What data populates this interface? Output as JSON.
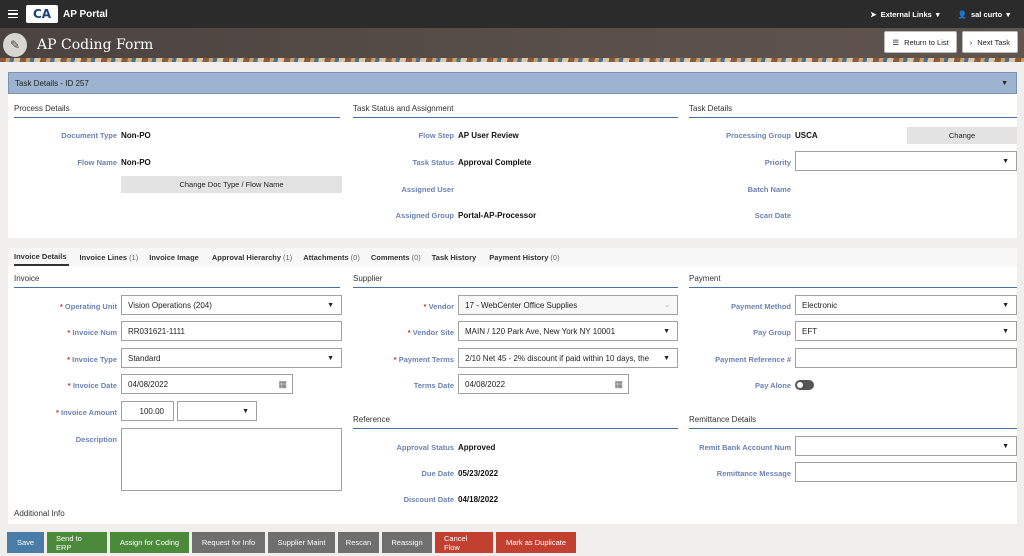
{
  "app": {
    "name": "AP Portal",
    "logo": "CA",
    "external_links": "External Links",
    "user": "sal curto"
  },
  "header": {
    "title": "AP Coding Form",
    "return_label": "Return to List",
    "next_label": "Next Task"
  },
  "panel": {
    "title": "Task Details - ID 257"
  },
  "process": {
    "heading": "Process Details",
    "doc_type_label": "Document Type",
    "doc_type": "Non-PO",
    "flow_name_label": "Flow Name",
    "flow_name": "Non-PO",
    "change_btn": "Change Doc Type / Flow Name"
  },
  "status": {
    "heading": "Task Status and Assignment",
    "flow_step_label": "Flow Step",
    "flow_step": "AP User Review",
    "task_status_label": "Task Status",
    "task_status": "Approval Complete",
    "assigned_user_label": "Assigned User",
    "assigned_group_label": "Assigned Group",
    "assigned_group": "Portal-AP-Processor"
  },
  "taskdetails": {
    "heading": "Task Details",
    "proc_group_label": "Processing Group",
    "proc_group": "USCA",
    "change_btn": "Change",
    "priority_label": "Priority",
    "batch_label": "Batch Name",
    "scan_label": "Scan Date"
  },
  "tabs": [
    {
      "label": "Invoice Details",
      "count": ""
    },
    {
      "label": "Invoice Lines",
      "count": "(1)"
    },
    {
      "label": "Invoice Image",
      "count": ""
    },
    {
      "label": "Approval Hierarchy",
      "count": "(1)"
    },
    {
      "label": "Attachments",
      "count": "(0)"
    },
    {
      "label": "Comments",
      "count": "(0)"
    },
    {
      "label": "Task History",
      "count": ""
    },
    {
      "label": "Payment History",
      "count": "(0)"
    }
  ],
  "invoice": {
    "heading": "Invoice",
    "op_unit_label": "Operating Unit",
    "op_unit": "Vision Operations (204)",
    "inv_num_label": "Invoice Num",
    "inv_num": "RR031621-1111",
    "inv_type_label": "Invoice Type",
    "inv_type": "Standard",
    "inv_date_label": "Invoice Date",
    "inv_date": "04/08/2022",
    "amount_label": "Invoice Amount",
    "amount": "100.00",
    "desc_label": "Description",
    "additional": "Additional Info"
  },
  "supplier": {
    "heading": "Supplier",
    "vendor_label": "Vendor",
    "vendor": "17 - WebCenter Office Supplies",
    "site_label": "Vendor Site",
    "site": "MAIN / 120 Park Ave, New York NY 10001",
    "terms_label": "Payment Terms",
    "terms": "2/10 Net 45 - 2% discount if paid within 10 days, the",
    "terms_date_label": "Terms Date",
    "terms_date": "04/08/2022"
  },
  "reference": {
    "heading": "Reference",
    "approval_label": "Approval Status",
    "approval": "Approved",
    "due_label": "Due Date",
    "due": "05/23/2022",
    "discount_label": "Discount Date",
    "discount": "04/18/2022"
  },
  "payment": {
    "heading": "Payment",
    "method_label": "Payment Method",
    "method": "Electronic",
    "group_label": "Pay Group",
    "group": "EFT",
    "ref_label": "Payment Reference #",
    "alone_label": "Pay Alone"
  },
  "remit": {
    "heading": "Remittance Details",
    "bank_label": "Remit Bank Account Num",
    "msg_label": "Remittance Message"
  },
  "footer": {
    "save": "Save",
    "send_erp": "Send to ERP",
    "assign": "Assign for Coding",
    "request": "Request for Info",
    "supplier_maint": "Supplier Maint",
    "rescan": "Rescan",
    "reassign": "Reassign",
    "cancel_flow": "Cancel Flow",
    "duplicate": "Mark as Duplicate"
  },
  "colors": {
    "accent": "#4a6fa5",
    "panel": "#9db4d1",
    "save": "#4a7ca8",
    "green": "#4a8a3a",
    "gray": "#6f6f6f",
    "red": "#c2402f"
  }
}
